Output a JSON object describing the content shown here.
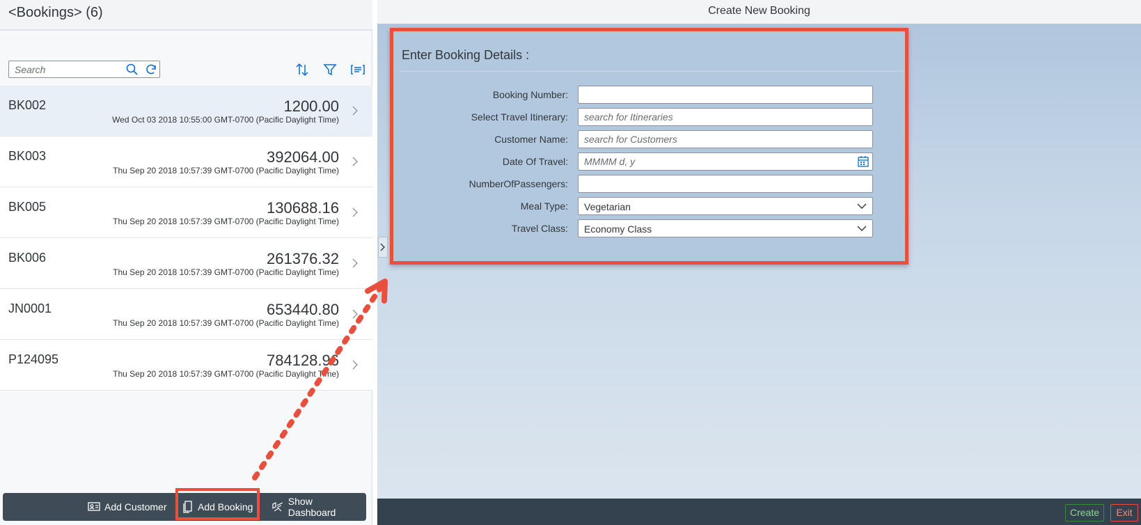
{
  "master": {
    "title": "<Bookings> (6)",
    "search_placeholder": "Search",
    "items": [
      {
        "id": "BK002",
        "amount": "1200.00",
        "date": "Wed Oct 03 2018 10:55:00 GMT-0700 (Pacific Daylight Time)"
      },
      {
        "id": "BK003",
        "amount": "392064.00",
        "date": "Thu Sep 20 2018 10:57:39 GMT-0700 (Pacific Daylight Time)"
      },
      {
        "id": "BK005",
        "amount": "130688.16",
        "date": "Thu Sep 20 2018 10:57:39 GMT-0700 (Pacific Daylight Time)"
      },
      {
        "id": "BK006",
        "amount": "261376.32",
        "date": "Thu Sep 20 2018 10:57:39 GMT-0700 (Pacific Daylight Time)"
      },
      {
        "id": "JN0001",
        "amount": "653440.80",
        "date": "Thu Sep 20 2018 10:57:39 GMT-0700 (Pacific Daylight Time)"
      },
      {
        "id": "P124095",
        "amount": "784128.96",
        "date": "Thu Sep 20 2018 10:57:39 GMT-0700 (Pacific Daylight Time)"
      }
    ],
    "footer": {
      "add_customer": "Add Customer",
      "add_booking": "Add Booking",
      "show_dashboard": "Show Dashboard"
    }
  },
  "detail": {
    "title": "Create New Booking",
    "form_title": "Enter Booking Details :",
    "fields": {
      "booking_number": {
        "label": "Booking Number:",
        "value": "",
        "placeholder": ""
      },
      "itinerary": {
        "label": "Select Travel Itinerary:",
        "placeholder": "search for Itineraries"
      },
      "customer": {
        "label": "Customer Name:",
        "placeholder": "search for Customers"
      },
      "date": {
        "label": "Date Of Travel:",
        "placeholder": "MMMM d, y"
      },
      "passengers": {
        "label": "NumberOfPassengers:",
        "value": ""
      },
      "meal": {
        "label": "Meal Type:",
        "value": "Vegetarian"
      },
      "travel_class": {
        "label": "Travel Class:",
        "value": "Economy Class"
      }
    },
    "footer": {
      "create": "Create",
      "exit": "Exit"
    }
  },
  "colors": {
    "annotation": "#e8503d",
    "selected_row": "#e8eff6",
    "footer_bg": "#3f4c58"
  }
}
